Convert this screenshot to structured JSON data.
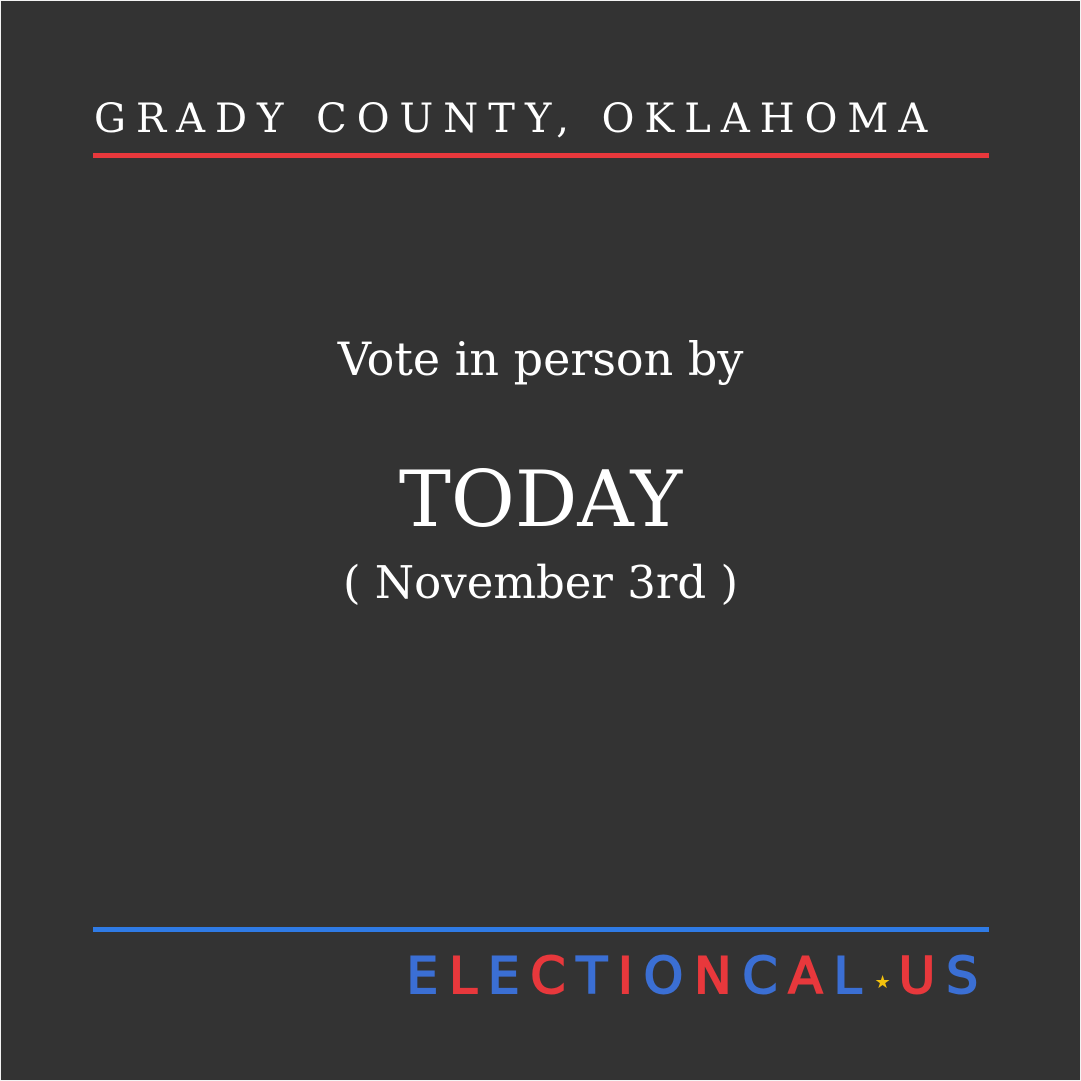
{
  "header": {
    "county": "GRADY COUNTY, OKLAHOMA"
  },
  "main": {
    "lead": "Vote in person by",
    "headline": "TODAY",
    "date": "( November 3rd )"
  },
  "logo": {
    "text": "ELECTIONCAL.US",
    "part1": "ELECTIONCAL",
    "part2": "US",
    "star_icon": "star-icon"
  },
  "colors": {
    "background": "#333333",
    "text": "#ffffff",
    "accent_red": "#e8383c",
    "accent_blue": "#2f7be6",
    "logo_red": "#e8383c",
    "logo_blue": "#3b6fd4",
    "star": "#f4c20d"
  }
}
